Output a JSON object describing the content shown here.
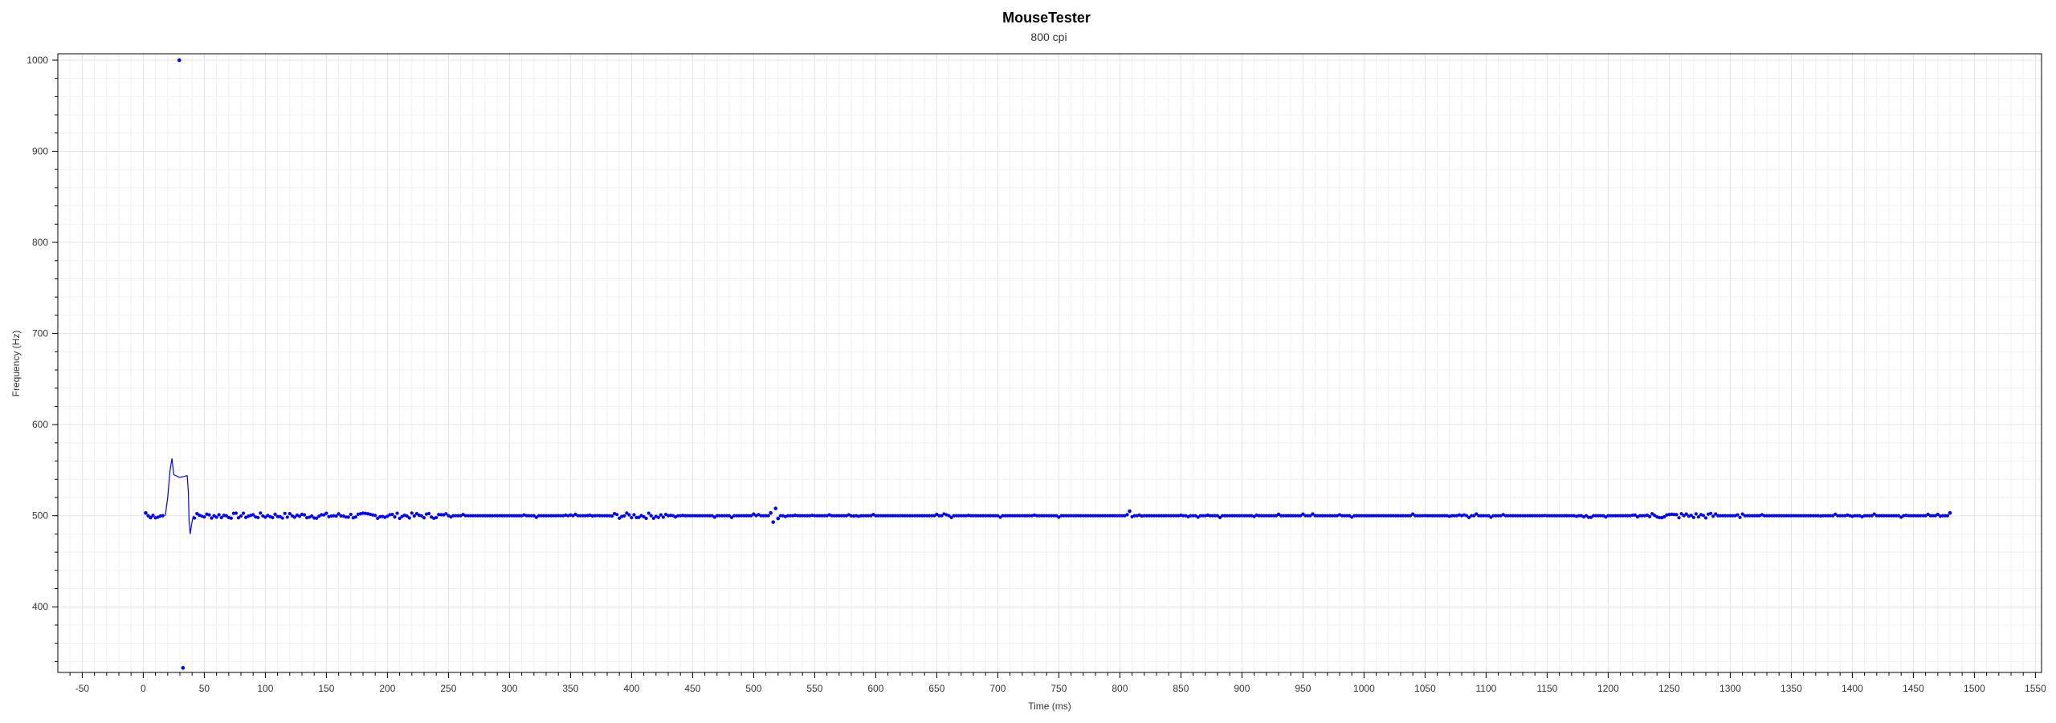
{
  "chart_data": {
    "type": "scatter",
    "title": "MouseTester",
    "subtitle": "800 cpi",
    "xlabel": "Time (ms)",
    "ylabel": "Frequency (Hz)",
    "xlim": [
      -70,
      1555
    ],
    "ylim": [
      328,
      1007
    ],
    "x_ticks": [
      -50,
      0,
      50,
      100,
      150,
      200,
      250,
      300,
      350,
      400,
      450,
      500,
      550,
      600,
      650,
      700,
      750,
      800,
      850,
      900,
      950,
      1000,
      1050,
      1100,
      1150,
      1200,
      1250,
      1300,
      1350,
      1400,
      1450,
      1500,
      1550
    ],
    "y_ticks": [
      400,
      500,
      600,
      700,
      800,
      900,
      1000
    ],
    "grid": true,
    "series": [
      {
        "style": "markers",
        "color": "#0000ff",
        "x_start": 2,
        "x_end": 1480,
        "x_step": 2,
        "base_value": 500,
        "points": [
          {
            "x": 29.5,
            "y": 1000
          },
          {
            "x": 32.5,
            "y": 333
          },
          {
            "x": 2,
            "y": 503
          },
          {
            "x": 6,
            "y": 498
          },
          {
            "x": 514,
            "y": 503
          },
          {
            "x": 516,
            "y": 493
          },
          {
            "x": 518,
            "y": 508
          },
          {
            "x": 520,
            "y": 497
          },
          {
            "x": 808,
            "y": 505
          },
          {
            "x": 1480,
            "y": 503
          }
        ]
      },
      {
        "style": "line",
        "color": "#0000ff",
        "points": [
          {
            "x": 18,
            "y": 500
          },
          {
            "x": 20,
            "y": 520
          },
          {
            "x": 22,
            "y": 550
          },
          {
            "x": 23.5,
            "y": 563
          },
          {
            "x": 25,
            "y": 545
          },
          {
            "x": 30,
            "y": 542
          },
          {
            "x": 36,
            "y": 544
          },
          {
            "x": 37,
            "y": 525
          },
          {
            "x": 37.5,
            "y": 495
          },
          {
            "x": 38.5,
            "y": 480
          },
          {
            "x": 39.5,
            "y": 490
          },
          {
            "x": 41,
            "y": 500
          }
        ]
      }
    ]
  }
}
